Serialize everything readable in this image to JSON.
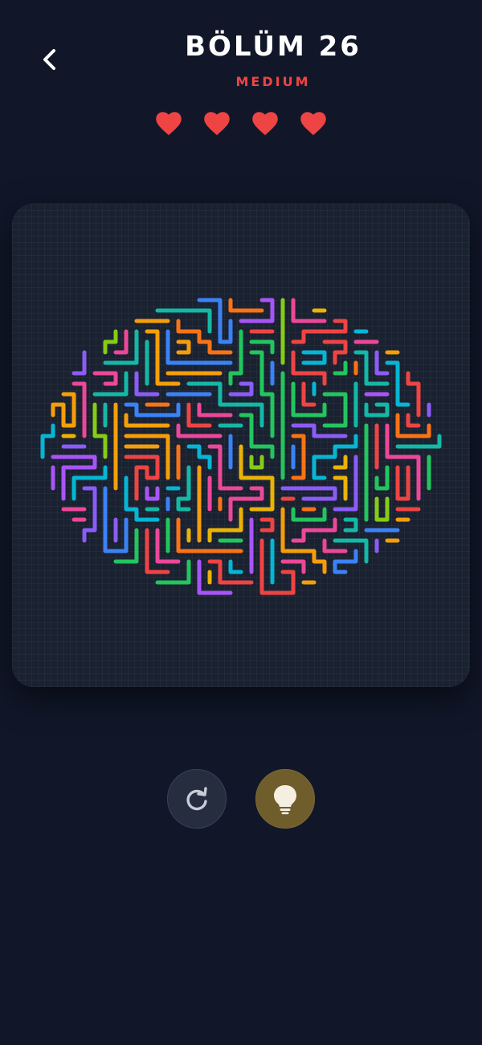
{
  "header": {
    "title": "BÖLÜM 26",
    "difficulty": "MEDIUM",
    "back_icon": "chevron-left-icon"
  },
  "lives": {
    "count": 4,
    "icon": "heart-icon",
    "color": "#ef4444"
  },
  "board": {
    "background": "#1a2130",
    "line_colors": [
      "#3b82f6",
      "#22c55e",
      "#f97316",
      "#a855f7",
      "#ef4444",
      "#06b6d4",
      "#84cc16",
      "#ec4899",
      "#14b8a6",
      "#eab308",
      "#8b5cf6",
      "#f59e0b"
    ]
  },
  "controls": {
    "restart_icon": "restart-icon",
    "hint_icon": "lightbulb-icon"
  },
  "colors": {
    "page_background": "#111729",
    "accent_red": "#ef4444",
    "hint_gold": "#6f5d2b"
  }
}
